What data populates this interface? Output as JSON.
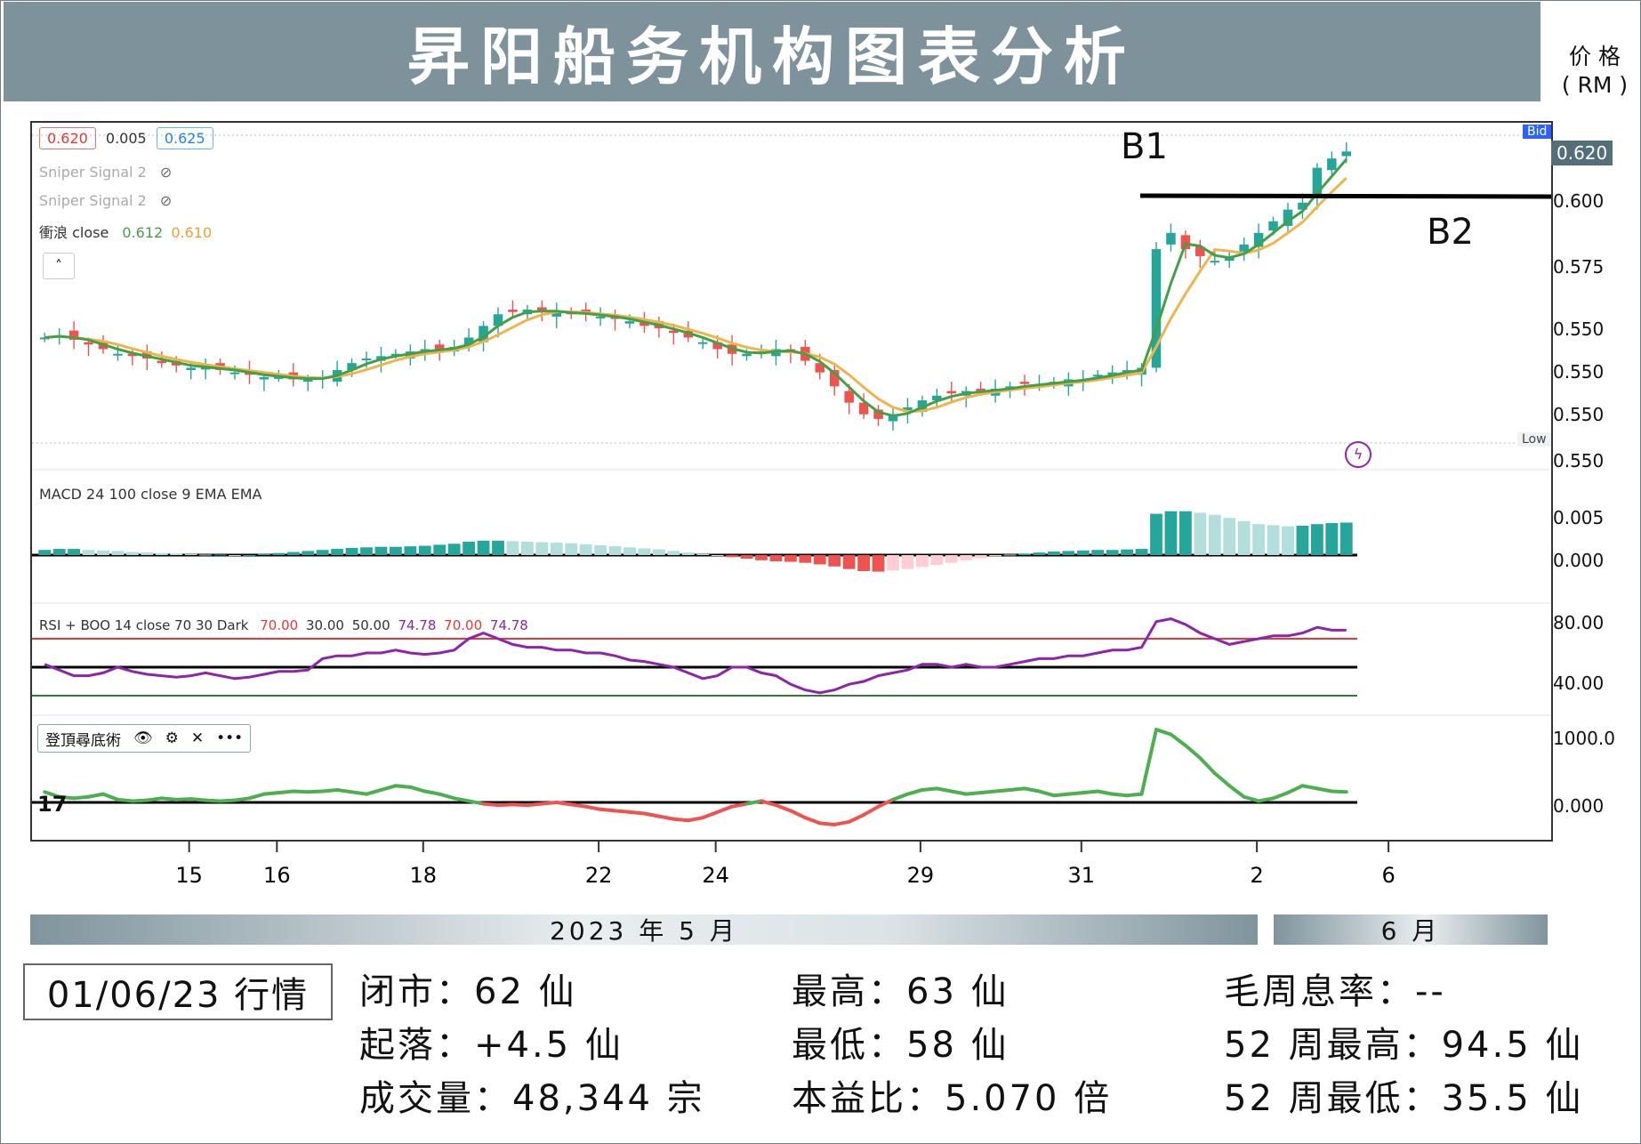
{
  "header": {
    "title": "昇阳船务机构图表分析",
    "unit_line1": "价 格",
    "unit_line2": "( RM )"
  },
  "legend": {
    "ohlc_open": "0.620",
    "ohlc_change": "0.005",
    "ohlc_close": "0.625",
    "sniper1": "Sniper Signal 2",
    "sniper2": "Sniper Signal 2",
    "ma_label": "衝浪 close",
    "ma_green_value": "0.612",
    "ma_orange_value": "0.610",
    "macd_label": "MACD 24 100 close 9 EMA EMA",
    "rsi_label_prefix": "RSI + BOO 14 close 70 30 Dark",
    "rsi_values": [
      "70.00",
      "30.00",
      "50.00",
      "74.78",
      "70.00",
      "74.78"
    ],
    "osc_label": "登頂尋底術",
    "bid_tag": "Bid",
    "low_tag": "Low",
    "last_price": "0.620",
    "b1": "B1",
    "b2": "B2"
  },
  "axis": {
    "price_ticks": [
      "0.600",
      "0.575",
      "0.550",
      "0.550",
      "0.550",
      "0.550"
    ],
    "macd_ticks": [
      "0.005",
      "0.000"
    ],
    "rsi_ticks": [
      "80.00",
      "40.00"
    ],
    "osc_ticks": [
      "1000.0",
      "0.000"
    ],
    "x_ticks": [
      "15",
      "16",
      "18",
      "22",
      "24",
      "29",
      "31",
      "2",
      "6"
    ]
  },
  "months": {
    "may": "2023 年 5 月",
    "june": "6 月"
  },
  "stats": {
    "date": "01/06/23 行情",
    "close": "闭市：62 仙",
    "change": "起落：+4.5 仙",
    "volume": "成交量：48,344 宗",
    "high": "最高：63 仙",
    "low": "最低：58 仙",
    "pe": "本益比：5.070 倍",
    "yield": "毛周息率：--",
    "high52": "52 周最高：94.5 仙",
    "low52": "52 周最低：35.5 仙"
  },
  "colors": {
    "up": "#26a69a",
    "down": "#ef5350",
    "ma_green": "#43a047",
    "ma_orange": "#f0b44c",
    "rsi": "#8e24aa",
    "osc_up": "#4caf50",
    "osc_down": "#ef5350",
    "title_bar": "#7e929b"
  },
  "chart_data": {
    "type": "candlestick",
    "price_range": [
      0.5,
      0.63
    ],
    "approx_close_series": [
      0.545,
      0.546,
      0.544,
      0.542,
      0.54,
      0.538,
      0.537,
      0.536,
      0.534,
      0.533,
      0.532,
      0.532,
      0.531,
      0.53,
      0.529,
      0.528,
      0.528,
      0.527,
      0.527,
      0.528,
      0.531,
      0.534,
      0.536,
      0.537,
      0.538,
      0.539,
      0.54,
      0.54,
      0.541,
      0.545,
      0.55,
      0.555,
      0.556,
      0.557,
      0.556,
      0.556,
      0.555,
      0.555,
      0.554,
      0.553,
      0.552,
      0.55,
      0.549,
      0.547,
      0.545,
      0.543,
      0.54,
      0.538,
      0.538,
      0.539,
      0.54,
      0.539,
      0.535,
      0.53,
      0.524,
      0.517,
      0.512,
      0.51,
      0.512,
      0.515,
      0.518,
      0.52,
      0.521,
      0.522,
      0.522,
      0.523,
      0.524,
      0.525,
      0.525,
      0.526,
      0.527,
      0.527,
      0.529,
      0.53,
      0.531,
      0.532,
      0.583,
      0.59,
      0.583,
      0.58,
      0.578,
      0.58,
      0.585,
      0.59,
      0.595,
      0.6,
      0.603,
      0.618,
      0.622,
      0.625
    ],
    "macd_histogram": [
      0.001,
      0.0012,
      0.0012,
      0.001,
      0.0009,
      0.0008,
      0.0006,
      0.0005,
      0.0004,
      0.0003,
      0.0002,
      0.0001,
      0.0001,
      0.0,
      0.0,
      0.0002,
      0.0004,
      0.0006,
      0.0008,
      0.001,
      0.0012,
      0.0014,
      0.0015,
      0.0016,
      0.0016,
      0.0017,
      0.0018,
      0.002,
      0.0022,
      0.0026,
      0.0028,
      0.0028,
      0.0027,
      0.0026,
      0.0025,
      0.0024,
      0.0023,
      0.0021,
      0.0019,
      0.0017,
      0.0015,
      0.0013,
      0.0011,
      0.0008,
      0.0005,
      0.0002,
      -0.0001,
      -0.0004,
      -0.0007,
      -0.001,
      -0.0012,
      -0.0013,
      -0.0015,
      -0.0018,
      -0.0022,
      -0.0027,
      -0.0031,
      -0.0032,
      -0.003,
      -0.0027,
      -0.0023,
      -0.0019,
      -0.0015,
      -0.001,
      -0.0006,
      -0.0002,
      0.0001,
      0.0003,
      0.0005,
      0.0007,
      0.0008,
      0.0009,
      0.001,
      0.001,
      0.0011,
      0.0012,
      0.008,
      0.0085,
      0.0085,
      0.0082,
      0.0078,
      0.0072,
      0.0066,
      0.006,
      0.0058,
      0.0056,
      0.0057,
      0.006,
      0.0062,
      0.0063
    ],
    "rsi_series": [
      52,
      48,
      44,
      44,
      46,
      50,
      47,
      45,
      44,
      43,
      44,
      46,
      44,
      42,
      43,
      45,
      47,
      47,
      48,
      56,
      58,
      58,
      60,
      60,
      62,
      60,
      59,
      60,
      62,
      70,
      74,
      70,
      66,
      64,
      64,
      62,
      62,
      60,
      60,
      58,
      55,
      54,
      52,
      50,
      46,
      42,
      44,
      50,
      50,
      46,
      44,
      38,
      34,
      32,
      34,
      38,
      40,
      44,
      46,
      48,
      52,
      52,
      50,
      52,
      50,
      50,
      52,
      54,
      56,
      56,
      58,
      58,
      60,
      62,
      62,
      64,
      82,
      84,
      80,
      74,
      70,
      66,
      68,
      70,
      72,
      72,
      74,
      78,
      76,
      76
    ],
    "osc_series": [
      150,
      80,
      60,
      80,
      120,
      40,
      20,
      30,
      60,
      40,
      50,
      30,
      20,
      30,
      60,
      120,
      140,
      160,
      150,
      160,
      180,
      150,
      120,
      180,
      240,
      220,
      160,
      120,
      60,
      20,
      -20,
      -40,
      -30,
      -40,
      -20,
      0,
      -30,
      -60,
      -100,
      -120,
      -140,
      -160,
      -200,
      -240,
      -260,
      -220,
      -140,
      -60,
      -20,
      20,
      -40,
      -120,
      -220,
      -300,
      -320,
      -280,
      -180,
      -60,
      40,
      120,
      180,
      200,
      160,
      120,
      140,
      160,
      180,
      200,
      160,
      100,
      120,
      140,
      160,
      120,
      100,
      120,
      1050,
      980,
      820,
      640,
      420,
      240,
      80,
      20,
      60,
      140,
      240,
      200,
      160,
      150
    ],
    "annotations": [
      {
        "label": "B1",
        "level": 0.606
      },
      {
        "label": "B2",
        "level": 0.606
      }
    ]
  }
}
